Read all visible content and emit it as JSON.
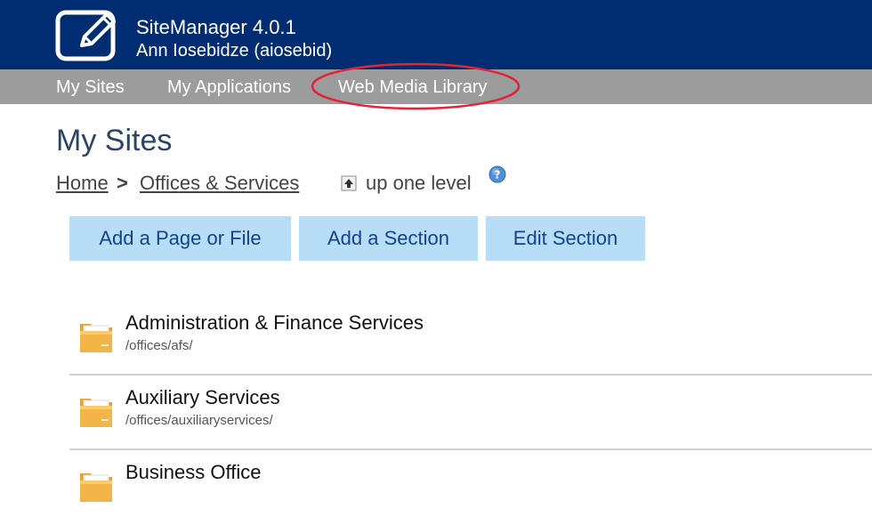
{
  "header": {
    "app_title": "SiteManager 4.0.1",
    "user_name": "Ann Iosebidze (aiosebid)",
    "logo_icon": "pencil-edit-icon"
  },
  "nav": {
    "items": [
      {
        "label": "My Sites"
      },
      {
        "label": "My Applications"
      },
      {
        "label": "Web Media Library"
      }
    ],
    "highlight_color": "#e0243a"
  },
  "page": {
    "title": "My Sites"
  },
  "breadcrumb": {
    "home": "Home",
    "separator": ">",
    "current": "Offices & Services",
    "up_label": "up one level"
  },
  "toolbar": {
    "add_page_label": "Add a Page or File",
    "add_section_label": "Add a Section",
    "edit_section_label": "Edit Section"
  },
  "sections": [
    {
      "title": "Administration & Finance Services",
      "path": "/offices/afs/"
    },
    {
      "title": "Auxiliary Services",
      "path": "/offices/auxiliaryservices/"
    },
    {
      "title": "Business Office",
      "path": ""
    }
  ],
  "colors": {
    "header_bg": "#002d72",
    "nav_bg": "#9c9c9c",
    "button_bg": "#b7def6",
    "button_text": "#12438c",
    "title_text": "#2d4466"
  }
}
